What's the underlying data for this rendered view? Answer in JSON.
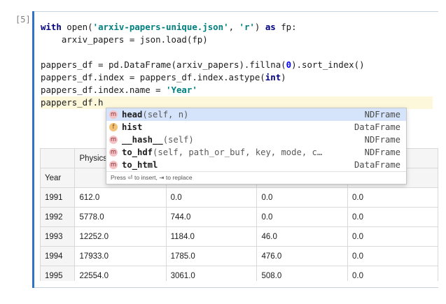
{
  "cell": {
    "prompt": "[5]",
    "code": {
      "l1": {
        "kw1": "with",
        "fn": " open(",
        "s1": "'arxiv-papers-unique.json'",
        "p1": ", ",
        "s2": "'r'",
        "p2": ") ",
        "kw2": "as",
        "p3": " fp:"
      },
      "l2": "    arxiv_papers = json.load(fp)",
      "l4": {
        "a": "pappers_df = pd.DataFrame(arxiv_papers).fillna(",
        "n": "0",
        "b": ").sort_index()"
      },
      "l5": {
        "a": "pappers_df.index = pappers_df.index.astype(",
        "t": "int",
        "b": ")"
      },
      "l6": {
        "a": "pappers_df.index.name = ",
        "s": "'Year'"
      },
      "l7": "pappers_df.h"
    }
  },
  "autocomplete": {
    "items": [
      {
        "badge": "m",
        "name": "head",
        "sig": "(self, n)",
        "type": "NDFrame"
      },
      {
        "badge": "f",
        "name": "hist",
        "sig": "",
        "type": "DataFrame"
      },
      {
        "badge": "m",
        "name": "__hash__",
        "sig": "(self)",
        "type": "NDFrame"
      },
      {
        "badge": "m",
        "name": "to_hdf",
        "sig": "(self, path_or_buf, key, mode, c…",
        "type": "NDFrame"
      },
      {
        "badge": "m",
        "name": "to_html",
        "sig": "",
        "type": "DataFrame"
      }
    ],
    "footer": "Press ⏎ to insert, ⇥ to replace"
  },
  "table": {
    "col_header": "Physics",
    "index_name": "Year",
    "rows": [
      {
        "year": "1991",
        "v": [
          "612.0",
          "0.0",
          "0.0",
          "0.0"
        ]
      },
      {
        "year": "1992",
        "v": [
          "5778.0",
          "744.0",
          "0.0",
          "0.0"
        ]
      },
      {
        "year": "1993",
        "v": [
          "12252.0",
          "1184.0",
          "46.0",
          "0.0"
        ]
      },
      {
        "year": "1994",
        "v": [
          "17933.0",
          "1785.0",
          "476.0",
          "0.0"
        ]
      },
      {
        "year": "1995",
        "v": [
          "22554.0",
          "3061.0",
          "508.0",
          "0.0"
        ]
      }
    ]
  }
}
